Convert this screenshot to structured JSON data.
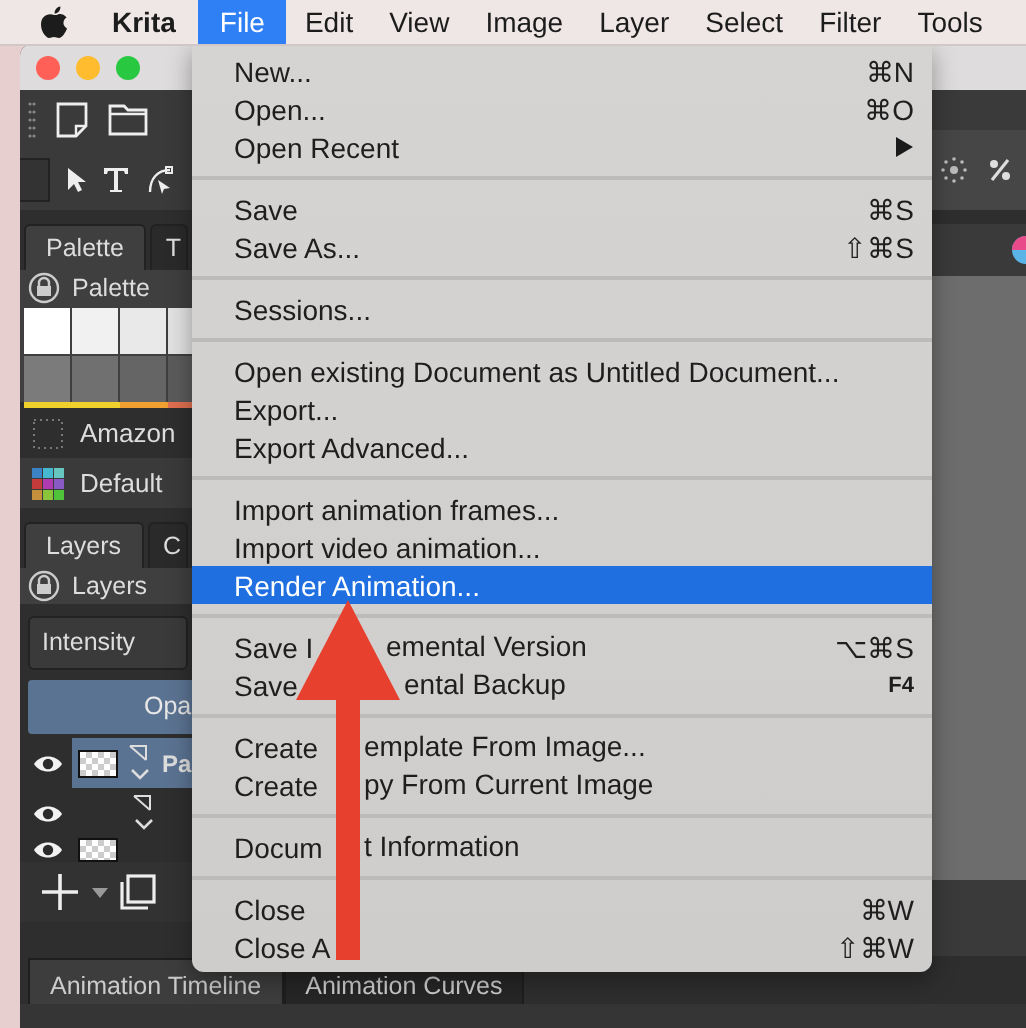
{
  "menu_bar": {
    "items": [
      {
        "label": "Krita",
        "kind": "app",
        "selected": false
      },
      {
        "label": "File",
        "kind": "menu",
        "selected": true
      },
      {
        "label": "Edit",
        "kind": "menu",
        "selected": false
      },
      {
        "label": "View",
        "kind": "menu",
        "selected": false
      },
      {
        "label": "Image",
        "kind": "menu",
        "selected": false
      },
      {
        "label": "Layer",
        "kind": "menu",
        "selected": false
      },
      {
        "label": "Select",
        "kind": "menu",
        "selected": false
      },
      {
        "label": "Filter",
        "kind": "menu",
        "selected": false
      },
      {
        "label": "Tools",
        "kind": "menu",
        "selected": false
      }
    ]
  },
  "left_panel": {
    "palette_tabs": [
      {
        "label": "Palette",
        "selected": true
      },
      {
        "label": "T",
        "selected": false
      }
    ],
    "palette_title": "Palette",
    "swatches": [
      {
        "color": "#ffffff"
      },
      {
        "color": "#f1f1f1"
      },
      {
        "color": "#e9e9e9"
      },
      {
        "color": "#e2e2e2"
      },
      {
        "color": "#7b7b7b"
      },
      {
        "color": "#707070"
      },
      {
        "color": "#656565"
      },
      {
        "color": "#5b5b5b"
      }
    ],
    "palettes": [
      {
        "label": "Amazon",
        "selected": true
      },
      {
        "label": "Default",
        "selected": false
      }
    ],
    "layer_tabs": [
      {
        "label": "Layers",
        "selected": true
      },
      {
        "label": "C",
        "selected": false
      }
    ],
    "layers_title": "Layers",
    "blend_mode": "Intensity",
    "opacity": {
      "label": "Opa",
      "level": 1
    },
    "layers": [
      {
        "name": "Pa",
        "selected": true
      },
      {
        "selected": false
      },
      {
        "selected": false
      }
    ]
  },
  "bottom_tabs": [
    {
      "label": "Animation Timeline",
      "selected": true
    },
    {
      "label": "Animation Curves",
      "selected": false
    }
  ],
  "file_menu": {
    "groups": [
      [
        {
          "label": "New...",
          "shortcut": "⌘N",
          "selected": false
        },
        {
          "label": "Open...",
          "shortcut": "⌘O",
          "selected": false
        },
        {
          "label": "Open Recent",
          "submenu": true,
          "selected": false
        }
      ],
      [
        {
          "label": "Save",
          "shortcut": "⌘S",
          "selected": false
        },
        {
          "label": "Save As...",
          "shortcut": "⇧⌘S",
          "selected": false
        }
      ],
      [
        {
          "label": "Sessions...",
          "selected": false
        }
      ],
      [
        {
          "label": "Open existing Document as Untitled Document...",
          "selected": false
        },
        {
          "label": "Export...",
          "selected": false
        },
        {
          "label": "Export Advanced...",
          "selected": false
        }
      ],
      [
        {
          "label": "Import animation frames...",
          "selected": false
        },
        {
          "label": "Import video animation...",
          "selected": false
        },
        {
          "label": "Render Animation...",
          "selected": true
        }
      ],
      [
        {
          "label": "Save I",
          "label_rest": "emental Version",
          "shortcut": "⌥⌘S",
          "selected": false
        },
        {
          "label": "Save",
          "label_rest": "ental Backup",
          "shortcut": "F4",
          "selected": false
        }
      ],
      [
        {
          "label": "Create",
          "label_rest": "emplate From Image...",
          "selected": false
        },
        {
          "label": "Create",
          "label_rest": "py From Current Image",
          "selected": false
        }
      ],
      [
        {
          "label": "Docum",
          "label_rest": "t Information",
          "selected": false
        }
      ],
      [
        {
          "label": "Close",
          "shortcut": "⌘W",
          "selected": false
        },
        {
          "label": "Close A",
          "shortcut": "⇧⌘W",
          "selected": false
        }
      ]
    ]
  }
}
